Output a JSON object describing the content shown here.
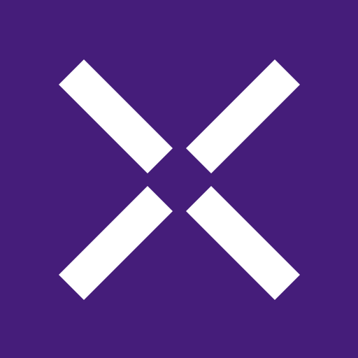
{
  "logo": {
    "icon": "x-mark-icon",
    "background_color": "#451d7a",
    "mark_color": "#ffffff"
  }
}
